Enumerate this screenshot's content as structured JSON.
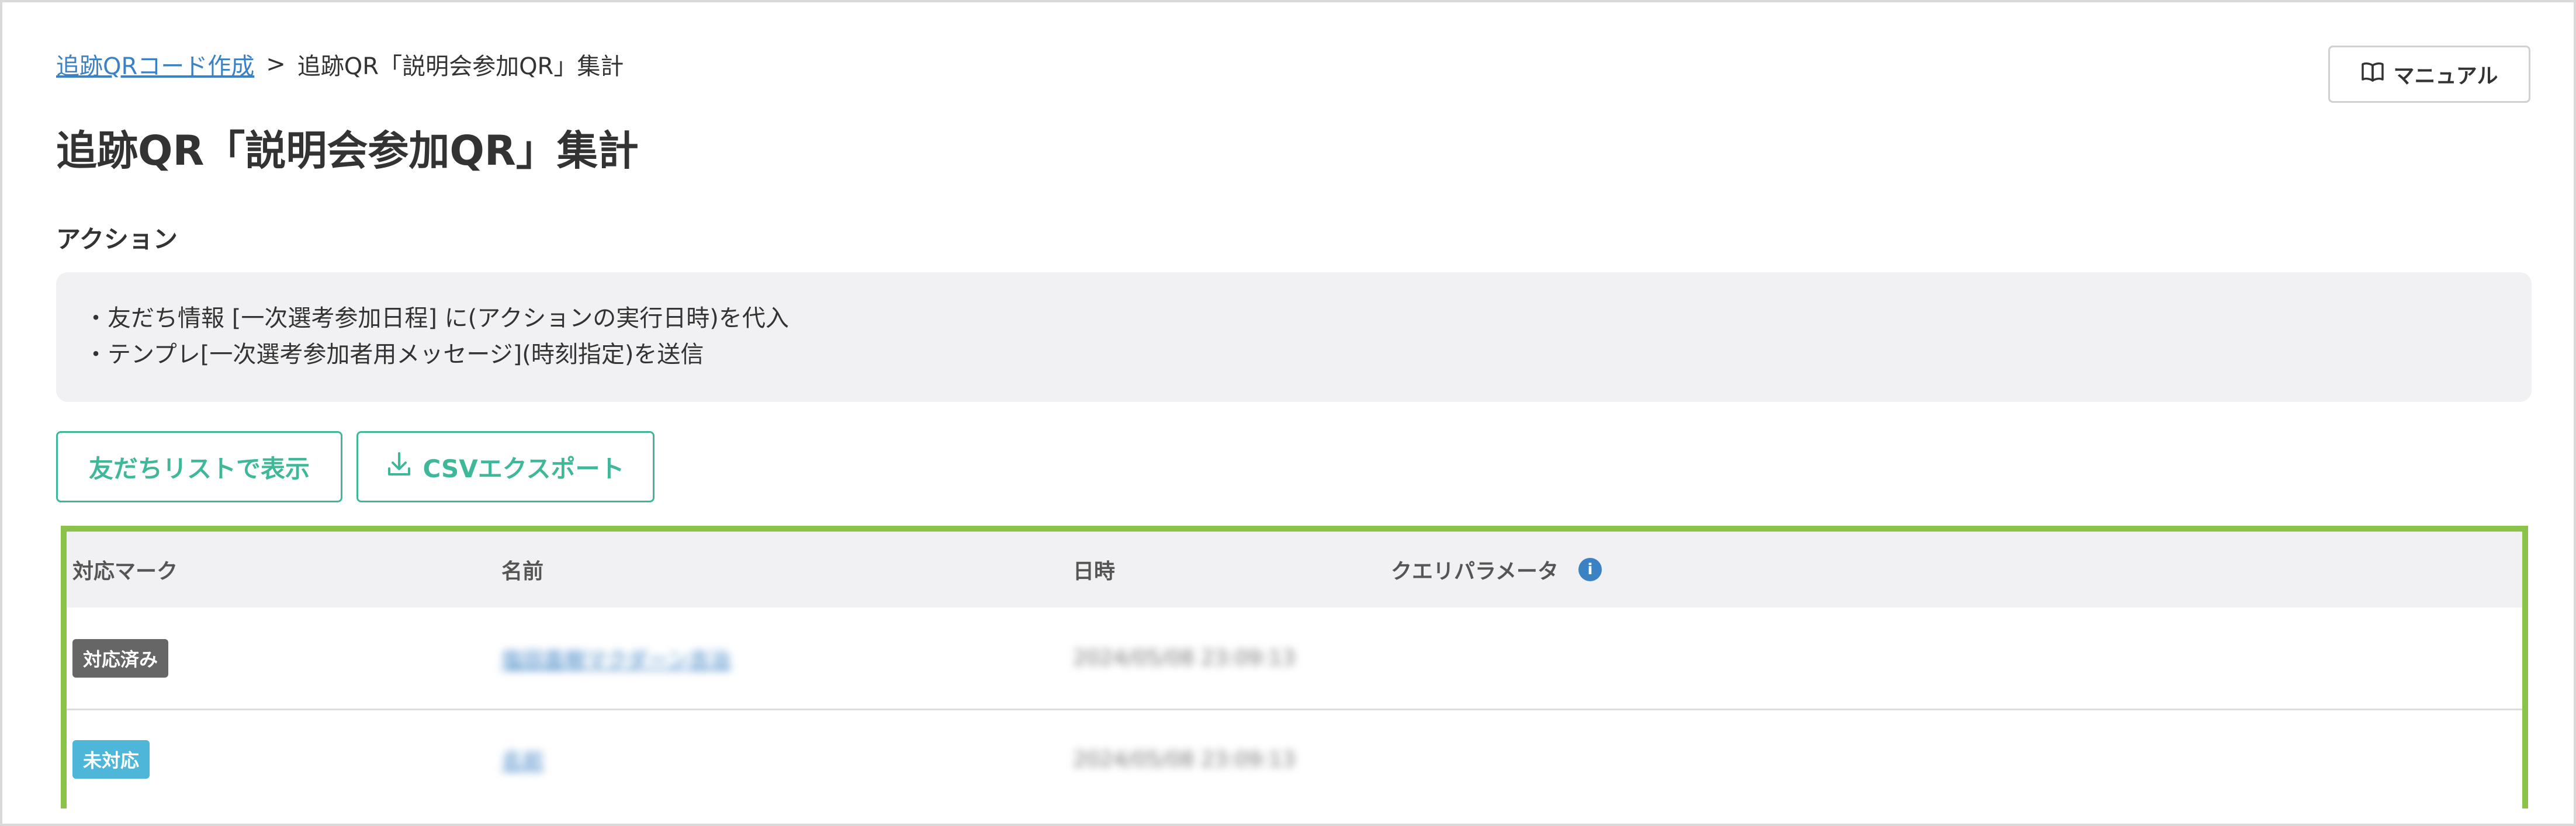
{
  "breadcrumb": {
    "parent_label": "追跡QRコード作成",
    "separator": ">",
    "current_label": "追跡QR「説明会参加QR」集計"
  },
  "header": {
    "manual_label": "マニュアル",
    "title": "追跡QR「説明会参加QR」集計"
  },
  "actions": {
    "label": "アクション",
    "lines": [
      "・友だち情報 [一次選考参加日程] に(アクションの実行日時)を代入",
      "・テンプレ[一次選考参加者用メッセージ](時刻指定)を送信"
    ]
  },
  "buttons": {
    "friends_list": "友だちリストで表示",
    "csv_export": "CSVエクスポート"
  },
  "table": {
    "columns": [
      "対応マーク",
      "名前",
      "日時",
      "クエリパラメータ"
    ],
    "info_icon": "i",
    "rows": [
      {
        "status": "対応済み",
        "status_color": "#666666",
        "name": "塩田直樹マクダーン吉治",
        "datetime": "2024/05/08 23:09:13",
        "query": ""
      },
      {
        "status": "未対応",
        "status_color": "#4db6d9",
        "name": "名前",
        "datetime": "2024/05/08 23:09:13",
        "query": ""
      }
    ]
  },
  "colors": {
    "accent": "#3fb89a",
    "link": "#3b82c4",
    "highlight_border": "#8bc34a"
  },
  "icons": {
    "manual": "book-icon",
    "csv": "download-icon",
    "query_help": "info-icon"
  }
}
